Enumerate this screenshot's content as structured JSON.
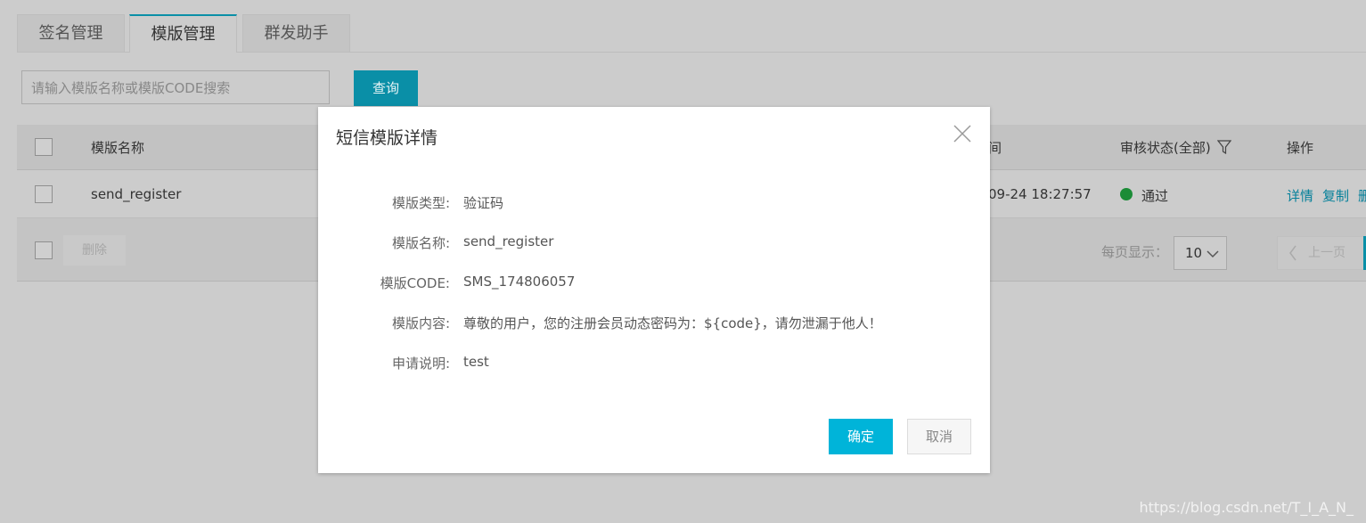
{
  "tabs": [
    "签名管理",
    "模版管理",
    "群发助手"
  ],
  "search": {
    "placeholder": "请输入模版名称或模版CODE搜索",
    "button": "查询"
  },
  "table": {
    "headers": {
      "name": "模版名称",
      "time": "间",
      "status": "审核状态(全部)",
      "actions": "操作"
    },
    "row": {
      "name": "send_register",
      "time": "09-24 18:27:57",
      "status": "通过",
      "status_color": "#1b8c37",
      "actions": [
        "详情",
        "复制",
        "删"
      ]
    },
    "footer": {
      "delete": "删除",
      "page_size_label": "每页显示：",
      "page_size": "10",
      "prev": "上一页"
    }
  },
  "modal": {
    "title": "短信模版详情",
    "fields": [
      {
        "label": "模版类型:",
        "value": "验证码"
      },
      {
        "label": "模版名称:",
        "value": "send_register"
      },
      {
        "label": "模版CODE:",
        "value": "SMS_174806057"
      },
      {
        "label": "模版内容:",
        "value": "尊敬的用户，您的注册会员动态密码为：${code}，请勿泄漏于他人！"
      },
      {
        "label": "申请说明:",
        "value": "test"
      }
    ],
    "confirm": "确定",
    "cancel": "取消"
  },
  "watermark": "https://blog.csdn.net/T_I_A_N_",
  "colors": {
    "accent": "#00b4d9",
    "dimmed_accent": "#0a8fa7"
  }
}
